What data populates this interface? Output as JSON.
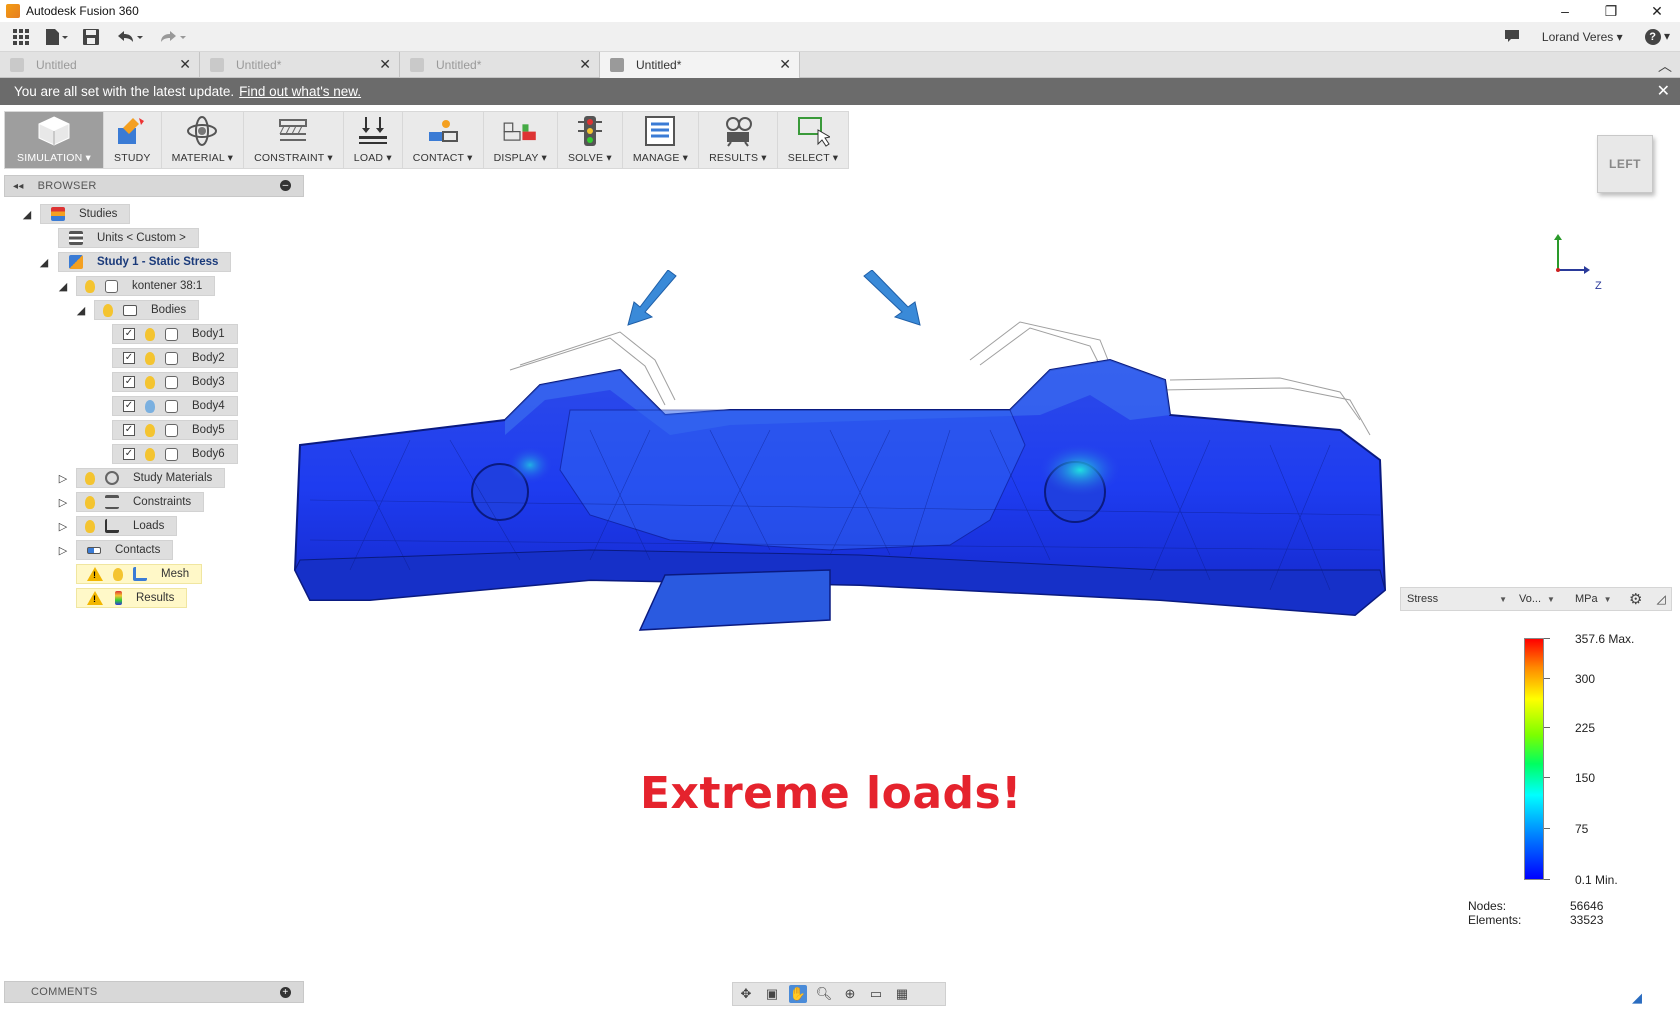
{
  "window": {
    "title": "Autodesk Fusion 360",
    "controls": [
      "–",
      "❐",
      "✕"
    ]
  },
  "qat": {
    "user": "Lorand Veres",
    "help": "?"
  },
  "tabs": [
    {
      "label": "Untitled",
      "active": false
    },
    {
      "label": "Untitled*",
      "active": false
    },
    {
      "label": "Untitled*",
      "active": false
    },
    {
      "label": "Untitled*",
      "active": true
    }
  ],
  "banner": {
    "text": "You are all set with the latest update.",
    "link": "Find out what's new."
  },
  "toolbar": {
    "workspace": "SIMULATION",
    "items": [
      "STUDY",
      "MATERIAL",
      "CONSTRAINT",
      "LOAD",
      "CONTACT",
      "DISPLAY",
      "SOLVE",
      "MANAGE",
      "RESULTS",
      "SELECT"
    ]
  },
  "viewcube": {
    "face": "LEFT"
  },
  "browser": {
    "title": "BROWSER",
    "studies": "Studies",
    "units": "Units < Custom >",
    "study": "Study 1 - Static Stress",
    "component": "kontener 38:1",
    "bodies_folder": "Bodies",
    "bodies": [
      "Body1",
      "Body2",
      "Body3",
      "Body4",
      "Body5",
      "Body6"
    ],
    "study_materials": "Study Materials",
    "constraints": "Constraints",
    "loads": "Loads",
    "contacts": "Contacts",
    "mesh": "Mesh",
    "results": "Results"
  },
  "callout": "Extreme loads!",
  "result_panel": {
    "type": "Stress",
    "component": "Vo...",
    "unit": "MPa"
  },
  "legend": {
    "max": "357.6 Max.",
    "t300": "300",
    "t225": "225",
    "t150": "150",
    "t75": "75",
    "min": "0.1 Min."
  },
  "stats": {
    "nodes_label": "Nodes:",
    "nodes_value": "56646",
    "elements_label": "Elements:",
    "elements_value": "33523"
  },
  "comments": {
    "title": "COMMENTS"
  },
  "axis": {
    "z": "Z"
  },
  "colors": {
    "banner": "#6b6b6b",
    "callout": "#e5232d",
    "workspace": "#9e9e9e"
  }
}
